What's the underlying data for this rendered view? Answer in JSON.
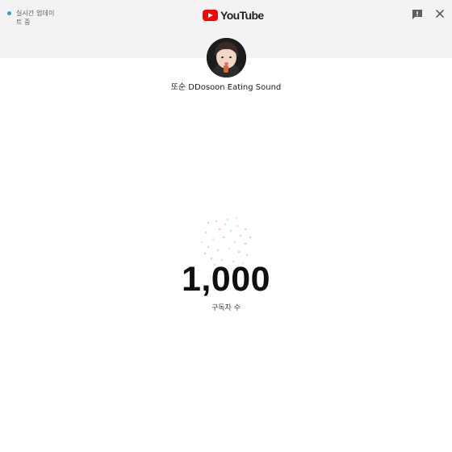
{
  "header": {
    "live_status_text": "실시간 업데이트 중",
    "logo_wordmark": "YouTube",
    "live_dot_color": "#2f9fd6",
    "logo_red": "#ff0000",
    "feedback_icon": "feedback-icon",
    "close_icon": "close-icon"
  },
  "channel": {
    "name": "또순 DDosoon Eating Sound",
    "avatar": "channel-avatar"
  },
  "counter": {
    "value": "1,000",
    "label": "구독자 수"
  },
  "confetti_colors": [
    "#f7b6d2",
    "#b6e3f7",
    "#c8f0a8",
    "#ffd8a8",
    "#d7c2f7",
    "#a8f0d9"
  ]
}
